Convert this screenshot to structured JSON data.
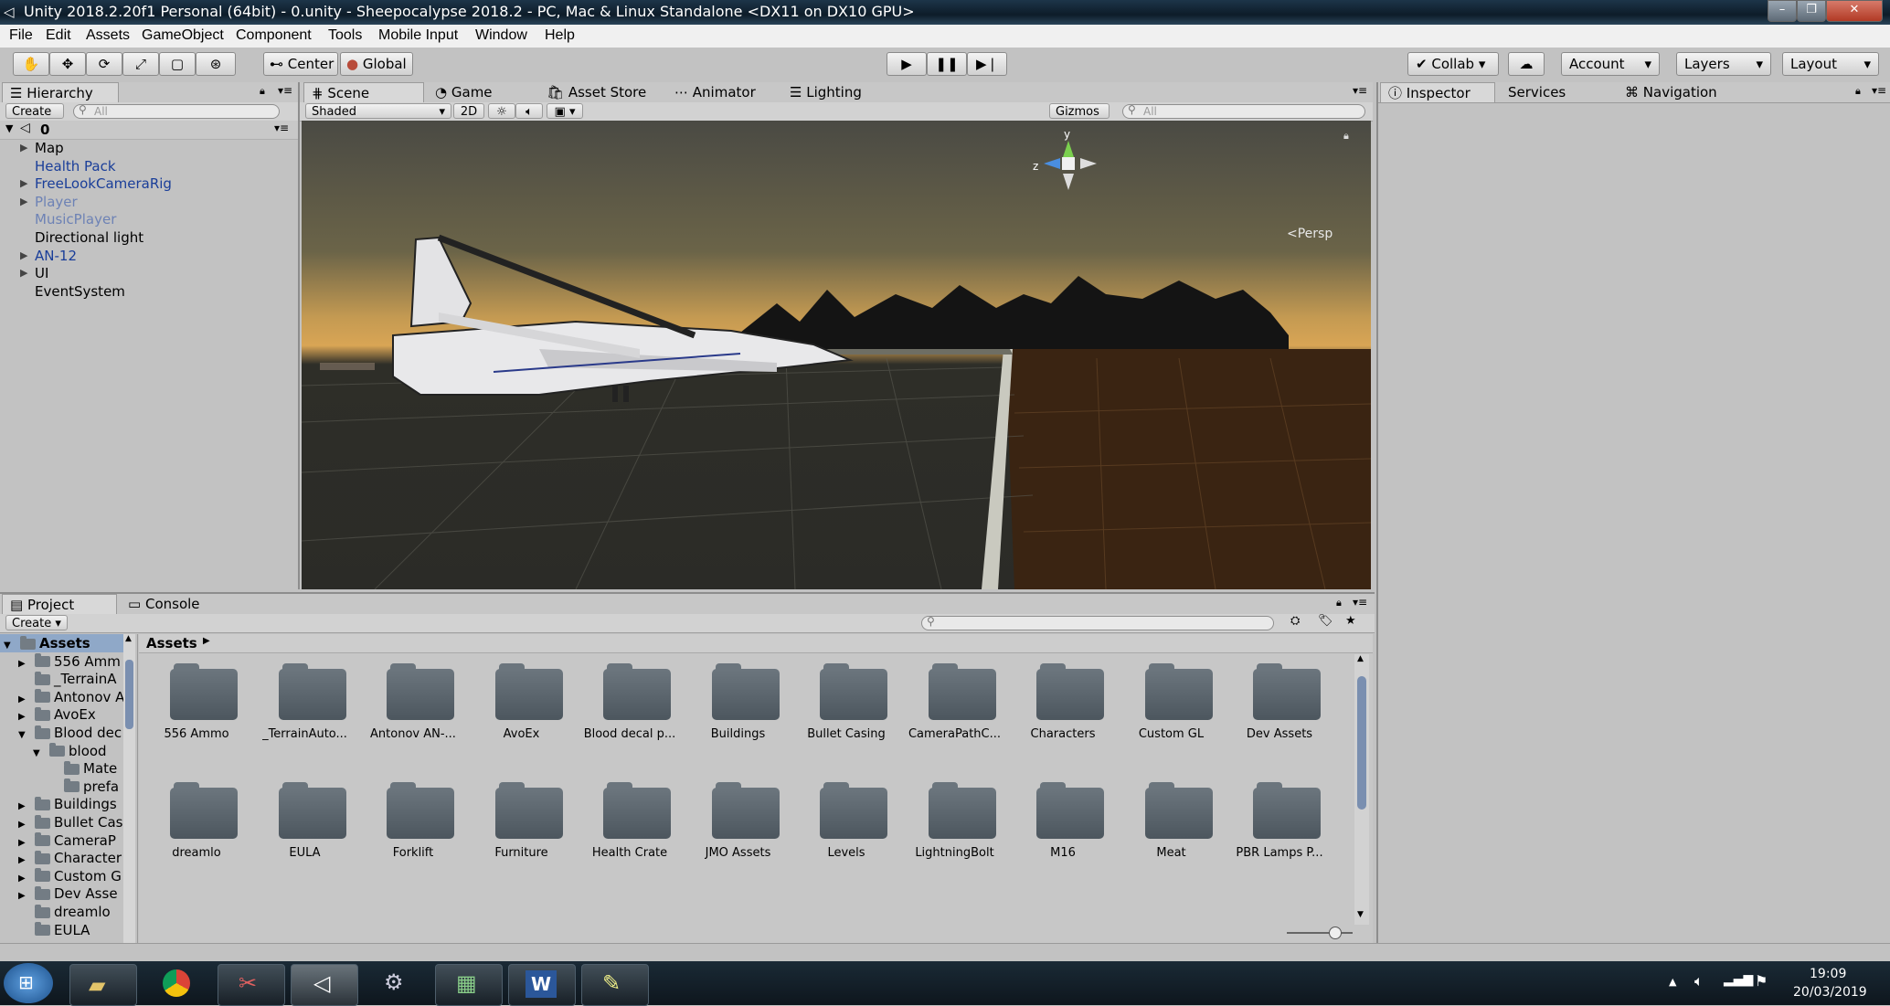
{
  "window": {
    "title": "Unity 2018.2.20f1 Personal (64bit) - 0.unity - Sheepocalypse 2018.2 - PC, Mac & Linux Standalone <DX11 on DX10 GPU>"
  },
  "menu": [
    "File",
    "Edit",
    "Assets",
    "GameObject",
    "Component",
    "Tools",
    "Mobile Input",
    "Window",
    "Help"
  ],
  "toolbar": {
    "pivot": "Center",
    "space": "Global",
    "collab": "Collab",
    "account": "Account",
    "layers": "Layers",
    "layout": "Layout"
  },
  "hierarchy": {
    "tab": "Hierarchy",
    "create": "Create",
    "search_placeholder": "All",
    "scene": "0",
    "items": [
      {
        "label": "Map",
        "expand": true,
        "color": "#000000"
      },
      {
        "label": "Health Pack",
        "expand": false,
        "color": "#1a3e99"
      },
      {
        "label": "FreeLookCameraRig",
        "expand": true,
        "color": "#1a3e99"
      },
      {
        "label": "Player",
        "expand": true,
        "color": "#6d82b5"
      },
      {
        "label": "MusicPlayer",
        "expand": false,
        "color": "#6d82b5"
      },
      {
        "label": "Directional light",
        "expand": false,
        "color": "#000000"
      },
      {
        "label": "AN-12",
        "expand": true,
        "color": "#1a3e99"
      },
      {
        "label": "UI",
        "expand": true,
        "color": "#000000"
      },
      {
        "label": "EventSystem",
        "expand": false,
        "color": "#000000"
      }
    ]
  },
  "scene_tabs": [
    "Scene",
    "Game",
    "Asset Store",
    "Animator",
    "Lighting"
  ],
  "scene_bar": {
    "shading": "Shaded",
    "mode2d": "2D",
    "gizmos": "Gizmos",
    "search_placeholder": "All",
    "persp": "Persp",
    "axis_y": "y",
    "axis_z": "z"
  },
  "inspector_tabs": [
    "Inspector",
    "Services",
    "Navigation"
  ],
  "project": {
    "tabs": [
      "Project",
      "Console"
    ],
    "create": "Create",
    "breadcrumb": "Assets",
    "tree": [
      {
        "label": "Assets",
        "depth": 0,
        "expand": "open",
        "selected": true
      },
      {
        "label": "556 Amm",
        "depth": 1,
        "expand": "closed"
      },
      {
        "label": "_TerrainA",
        "depth": 1,
        "expand": "none"
      },
      {
        "label": "Antonov A",
        "depth": 1,
        "expand": "closed"
      },
      {
        "label": "AvoEx",
        "depth": 1,
        "expand": "closed"
      },
      {
        "label": "Blood dec",
        "depth": 1,
        "expand": "open"
      },
      {
        "label": "blood",
        "depth": 2,
        "expand": "open"
      },
      {
        "label": "Mate",
        "depth": 3,
        "expand": "none"
      },
      {
        "label": "prefa",
        "depth": 3,
        "expand": "none"
      },
      {
        "label": "Buildings",
        "depth": 1,
        "expand": "closed"
      },
      {
        "label": "Bullet Cas",
        "depth": 1,
        "expand": "closed"
      },
      {
        "label": "CameraP",
        "depth": 1,
        "expand": "closed"
      },
      {
        "label": "Character",
        "depth": 1,
        "expand": "closed"
      },
      {
        "label": "Custom G",
        "depth": 1,
        "expand": "closed"
      },
      {
        "label": "Dev Asse",
        "depth": 1,
        "expand": "closed"
      },
      {
        "label": "dreamlo",
        "depth": 1,
        "expand": "none"
      },
      {
        "label": "EULA",
        "depth": 1,
        "expand": "none"
      }
    ],
    "folders_row1": [
      "556 Ammo",
      "_TerrainAuto...",
      "Antonov AN-...",
      "AvoEx",
      "Blood decal p...",
      "Buildings",
      "Bullet Casing",
      "CameraPathC...",
      "Characters",
      "Custom GL",
      "Dev Assets"
    ],
    "folders_row2": [
      "dreamlo",
      "EULA",
      "Forklift",
      "Furniture",
      "Health Crate",
      "JMO Assets",
      "Levels",
      "LightningBolt",
      "M16",
      "Meat",
      "PBR Lamps P..."
    ]
  },
  "taskbar": {
    "time": "19:09",
    "date": "20/03/2019"
  }
}
